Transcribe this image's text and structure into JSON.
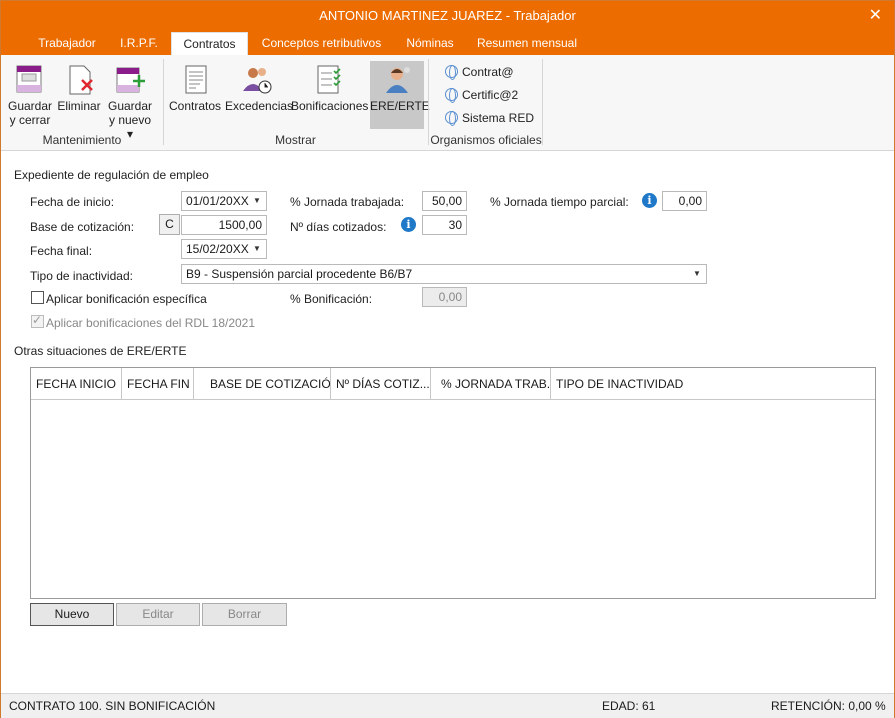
{
  "window": {
    "title": "ANTONIO MARTINEZ JUAREZ - Trabajador",
    "close_glyph": "✕"
  },
  "tabs": [
    "Trabajador",
    "I.R.P.F.",
    "Contratos",
    "Conceptos retributivos",
    "Nóminas",
    "Resumen mensual"
  ],
  "ribbon": {
    "mantenimiento": {
      "label": "Mantenimiento",
      "save_close": [
        "Guardar",
        "y cerrar"
      ],
      "delete": "Eliminar",
      "save_new": [
        "Guardar",
        "y nuevo ▾"
      ]
    },
    "mostrar": {
      "label": "Mostrar",
      "items": [
        "Contratos",
        "Excedencias",
        "Bonificaciones",
        "ERE/ERTE"
      ]
    },
    "organismos": {
      "label": "Organismos oficiales",
      "items": [
        "Contrat@",
        "Certific@2",
        "Sistema RED"
      ]
    }
  },
  "form": {
    "section_title": "Expediente de regulación de empleo",
    "fecha_inicio_label": "Fecha de inicio:",
    "fecha_inicio": "01/01/20XX",
    "jornada_label": "% Jornada trabajada:",
    "jornada": "50,00",
    "jornada_parcial_label": "% Jornada tiempo parcial:",
    "jornada_parcial": "0,00",
    "base_label": "Base de cotización:",
    "base_btn": "C",
    "base": "1500,00",
    "dias_label": "Nº días cotizados:",
    "dias": "30",
    "fecha_final_label": "Fecha final:",
    "fecha_final": "15/02/20XX",
    "inactividad_label": "Tipo de inactividad:",
    "inactividad": "B9 - Suspensión parcial procedente B6/B7",
    "bonif_check_label": "Aplicar bonificación específica",
    "bonif_pct_label": "% Bonificación:",
    "bonif_pct": "0,00",
    "rdl_label": "Aplicar bonificaciones del RDL 18/2021",
    "info_glyph": "i",
    "dropdown_glyph": "▼",
    "check_glyph": "✓"
  },
  "grid": {
    "title": "Otras situaciones de ERE/ERTE",
    "columns": [
      "FECHA INICIO",
      "FECHA FIN",
      "BASE DE COTIZACIÓN",
      "Nº DÍAS COTIZ...",
      "% JORNADA TRAB...",
      "TIPO DE INACTIVIDAD"
    ],
    "rows": []
  },
  "buttons": {
    "nuevo": "Nuevo",
    "editar": "Editar",
    "borrar": "Borrar"
  },
  "status": {
    "contrato": "CONTRATO 100.  SIN BONIFICACIÓN",
    "edad": "EDAD: 61",
    "retencion": "RETENCIÓN: 0,00 %"
  },
  "colors": {
    "accent": "#ec6c00",
    "info": "#1f78c8"
  }
}
